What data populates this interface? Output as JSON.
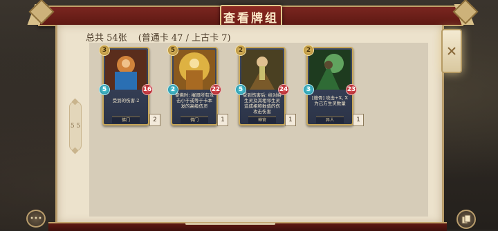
{
  "header": {
    "title": "查看牌组"
  },
  "summary": {
    "total": "总共 54张",
    "breakdown": "(普通卡 47 / 上古卡 7)"
  },
  "pager": {
    "label": "5 5"
  },
  "cards": [
    {
      "cost": "3",
      "atk": "5",
      "hp": "16",
      "desc": "受到的伤害-2",
      "tag": "佛门",
      "count": "2",
      "art_colors": [
        "#2a6fb3",
        "#d1833b",
        "#6b2f1f"
      ]
    },
    {
      "cost": "5",
      "atk": "2",
      "hp": "22",
      "desc": "使佛时: 摧毁所有攻击小于或等于卡本发的高级伍灵",
      "tag": "佛门",
      "count": "1",
      "art_colors": [
        "#f2c84b",
        "#a86a22",
        "#5a3816"
      ]
    },
    {
      "cost": "2",
      "atk": "5",
      "hp": "24",
      "desc": "受到伤害后: 给对峙生灵及其相邻生灵造成相称数值的伤攻击伤害",
      "tag": "神官",
      "count": "1",
      "art_colors": [
        "#c9c070",
        "#7a5a2a",
        "#2e2418"
      ]
    },
    {
      "cost": "2",
      "atk": "3",
      "hp": "23",
      "desc": "[缠骨] 攻击+X, X为己方生灵数量",
      "tag": "异人",
      "count": "1",
      "art_colors": [
        "#7ed07a",
        "#2f6b35",
        "#142814"
      ]
    }
  ],
  "icons": {
    "close": "close-icon",
    "menu": "menu-icon",
    "deck": "deck-icon"
  }
}
